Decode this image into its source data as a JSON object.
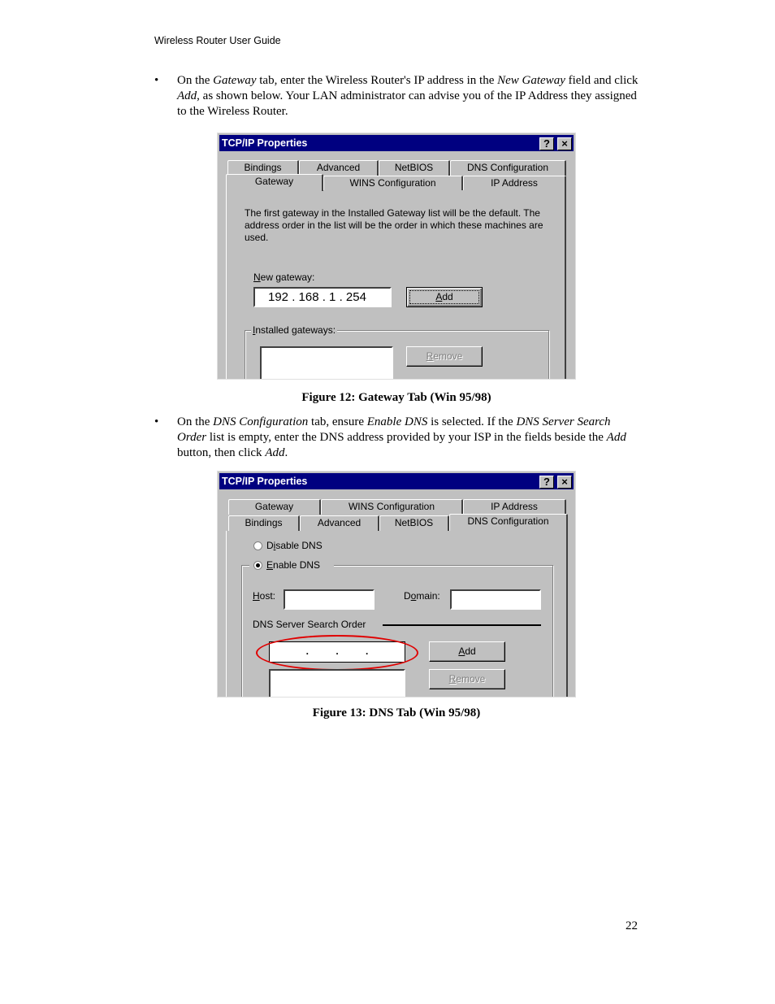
{
  "header": {
    "running_title": "Wireless Router User Guide"
  },
  "paragraphs": {
    "gateway_instruction": {
      "bullet": "•",
      "parts": [
        "On the ",
        "Gateway",
        " tab, enter the Wireless Router's IP address in the ",
        "New Gateway",
        " field and click ",
        "Add",
        ", as shown below. Your LAN administrator can advise you of the IP Address they assigned to the Wireless Router."
      ]
    },
    "dns_instruction": {
      "bullet": "•",
      "parts": [
        "On the ",
        "DNS Configuration",
        " tab, ensure ",
        "Enable DNS",
        " is selected. If the ",
        "DNS Server Search Order",
        " list is empty, enter the DNS address provided by your ISP in the fields beside the ",
        "Add",
        " button, then click ",
        "Add",
        "."
      ]
    }
  },
  "figure12": {
    "caption": "Figure 12: Gateway Tab (Win 95/98)",
    "window_title": "TCP/IP Properties",
    "help_button": "?",
    "close_button": "×",
    "tabs_back_row": [
      "Bindings",
      "Advanced",
      "NetBIOS",
      "DNS Configuration"
    ],
    "tabs_front_row": [
      "Gateway",
      "WINS Configuration",
      "IP Address"
    ],
    "active_tab": "Gateway",
    "description": "The first gateway in the Installed Gateway list will be the default. The address order in the list will be the order in which these machines are used.",
    "new_gateway_label_accel": "N",
    "new_gateway_label_rest": "ew gateway:",
    "new_gateway_value": "192 . 168 . 1 . 254",
    "add_button_accel": "A",
    "add_button_rest": "dd",
    "installed_gateways_accel": "I",
    "installed_gateways_rest": "nstalled gateways:",
    "remove_button_accel": "R",
    "remove_button_rest": "emove"
  },
  "figure13": {
    "caption": "Figure 13: DNS Tab (Win 95/98)",
    "window_title": "TCP/IP Properties",
    "help_button": "?",
    "close_button": "×",
    "tabs_back_row": [
      "Gateway",
      "WINS Configuration",
      "IP Address"
    ],
    "tabs_front_row": [
      "Bindings",
      "Advanced",
      "NetBIOS",
      "DNS Configuration"
    ],
    "active_tab": "DNS Configuration",
    "disable_dns_pre": "D",
    "disable_dns_accel": "i",
    "disable_dns_rest": "sable DNS",
    "enable_dns_accel": "E",
    "enable_dns_rest": "nable DNS",
    "enable_dns_selected": true,
    "host_accel": "H",
    "host_rest": "ost:",
    "host_value": "",
    "domain_pre": "D",
    "domain_accel": "o",
    "domain_rest": "main:",
    "domain_value": "",
    "search_order_label": "DNS Server Search Order",
    "dns_ip_value": ".          .          .",
    "add_button_accel": "A",
    "add_button_rest": "dd",
    "remove_button_accel": "R",
    "remove_button_rest": "emove",
    "highlight_color": "#e00000"
  },
  "footer": {
    "page_number": "22"
  },
  "colors": {
    "titlebar": "#000080",
    "dialog_face": "#c0c0c0"
  }
}
